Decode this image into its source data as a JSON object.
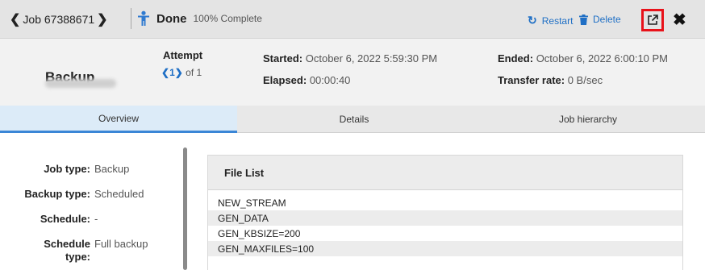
{
  "header": {
    "job_label": "Job 67388671",
    "status": "Done",
    "progress": "100% Complete",
    "restart_label": "Restart",
    "delete_label": "Delete"
  },
  "summary": {
    "name": "Backup",
    "attempt_label": "Attempt",
    "attempt_current": "1",
    "attempt_total": "of 1",
    "started_label": "Started:",
    "started_value": "October 6, 2022 5:59:30 PM",
    "elapsed_label": "Elapsed:",
    "elapsed_value": "00:00:40",
    "ended_label": "Ended:",
    "ended_value": "October 6, 2022 6:00:10 PM",
    "rate_label": "Transfer rate:",
    "rate_value": "0 B/sec"
  },
  "tabs": [
    {
      "label": "Overview"
    },
    {
      "label": "Details"
    },
    {
      "label": "Job hierarchy"
    }
  ],
  "overview": {
    "job_type_label": "Job type:",
    "job_type_value": "Backup",
    "backup_type_label": "Backup type:",
    "backup_type_value": "Scheduled",
    "schedule_label": "Schedule:",
    "schedule_value": "-",
    "schedule_type_label_1": "Schedule",
    "schedule_type_label_2": "type:",
    "schedule_type_value": "Full backup"
  },
  "file_list": {
    "title": "File List",
    "rows": [
      "NEW_STREAM",
      "GEN_DATA",
      "GEN_KBSIZE=200",
      "GEN_MAXFILES=100"
    ]
  },
  "colors": {
    "accent": "#1f6fc5",
    "highlight_box": "#e8121a",
    "active_tab": "#dcebf8"
  }
}
